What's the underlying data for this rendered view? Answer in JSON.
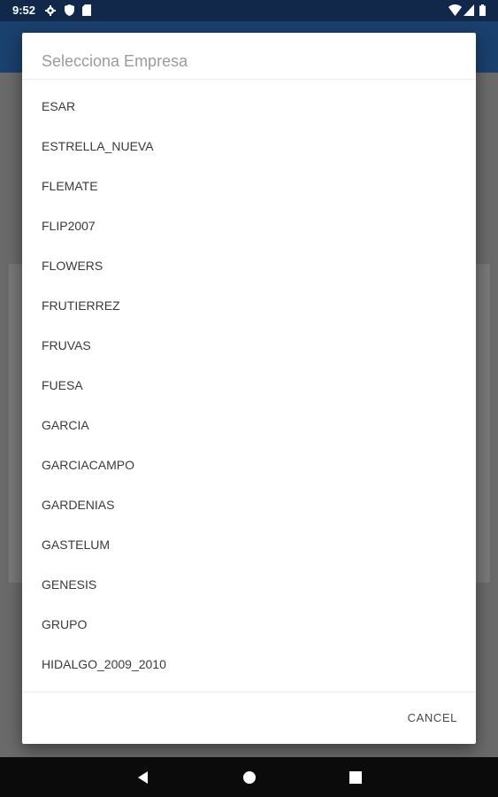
{
  "status_bar": {
    "time": "9:52",
    "icons": [
      "gear-icon",
      "shield-icon",
      "sd-card-icon",
      "wifi-icon",
      "signal-icon",
      "battery-icon"
    ]
  },
  "dialog": {
    "title": "Selecciona Empresa",
    "items": [
      "ESAR",
      "ESTRELLA_NUEVA",
      "FLEMATE",
      "FLIP2007",
      "FLOWERS",
      "FRUTIERREZ",
      "FRUVAS",
      "FUESA",
      "GARCIA",
      "GARCIACAMPO",
      "GARDENIAS",
      "GASTELUM",
      "GENESIS",
      "GRUPO",
      "HIDALGO_2009_2010"
    ],
    "cancel_label": "CANCEL"
  },
  "nav_bar": {
    "icons": [
      "back-icon",
      "home-icon",
      "recents-icon"
    ]
  },
  "colors": {
    "status_bar": "#12284a",
    "app_bar": "#1a406d",
    "scrim": "#646464",
    "dialog_bg": "#ffffff",
    "title_text": "#9b9b9b",
    "item_text": "#3a3a3a"
  }
}
